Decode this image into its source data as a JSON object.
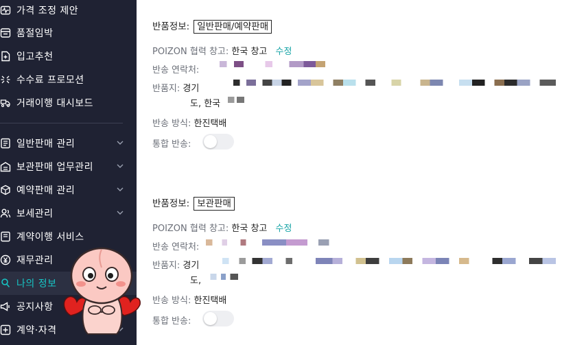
{
  "sidebar": {
    "items": [
      {
        "label": "가격 조정 제안",
        "icon": "pulse-icon"
      },
      {
        "label": "품절임박",
        "icon": "box-icon"
      },
      {
        "label": "입고추천",
        "icon": "plus-box-icon"
      },
      {
        "label": "수수료 프로모션",
        "icon": "gift-icon"
      },
      {
        "label": "거래이행 대시보드",
        "icon": "truck-icon"
      },
      {
        "label": "일반판매 관리",
        "icon": "list-icon"
      },
      {
        "label": "보관판매 업무관리",
        "icon": "warehouse-icon"
      },
      {
        "label": "예약판매 관리",
        "icon": "cube-icon"
      },
      {
        "label": "보세관리",
        "icon": "users-icon"
      },
      {
        "label": "계약이행 서비스",
        "icon": "document-icon"
      },
      {
        "label": "재무관리",
        "icon": "yen-icon"
      },
      {
        "label": "나의 정보",
        "icon": "user-icon"
      },
      {
        "label": "공지사항",
        "icon": "megaphone-icon"
      },
      {
        "label": "계약·자격",
        "icon": "plus-square-icon"
      }
    ],
    "active_index": 11,
    "accent_color": "#17c5c5"
  },
  "returns": [
    {
      "title_label": "반품정보:",
      "type": "일반판매/예약판매",
      "warehouse_label": "POIZON 협력 창고:",
      "warehouse_value": "한국 창고",
      "edit_label": "수정",
      "contact_label": "반송 연락처:",
      "address_label": "반품지:",
      "address_line1": "경기",
      "address_line2": "도, 한국 ",
      "method_label": "반송 방식:",
      "method_value": "한진택배",
      "merge_label": "통합 반송:"
    },
    {
      "title_label": "반품정보:",
      "type": "보관판매",
      "warehouse_label": "POIZON 협력 창고:",
      "warehouse_value": "한국 창고",
      "edit_label": "수정",
      "contact_label": "반송 연락처:",
      "address_label": "반품지:",
      "address_line1": "경기",
      "address_line2": "도, ",
      "method_label": "반송 방식:",
      "method_value": "한진택배",
      "merge_label": "통합 반송:"
    }
  ],
  "colors": {
    "sidebar_bg": "#1f2233",
    "link": "#16a4a6",
    "toggle_off": "#eeeff2"
  }
}
